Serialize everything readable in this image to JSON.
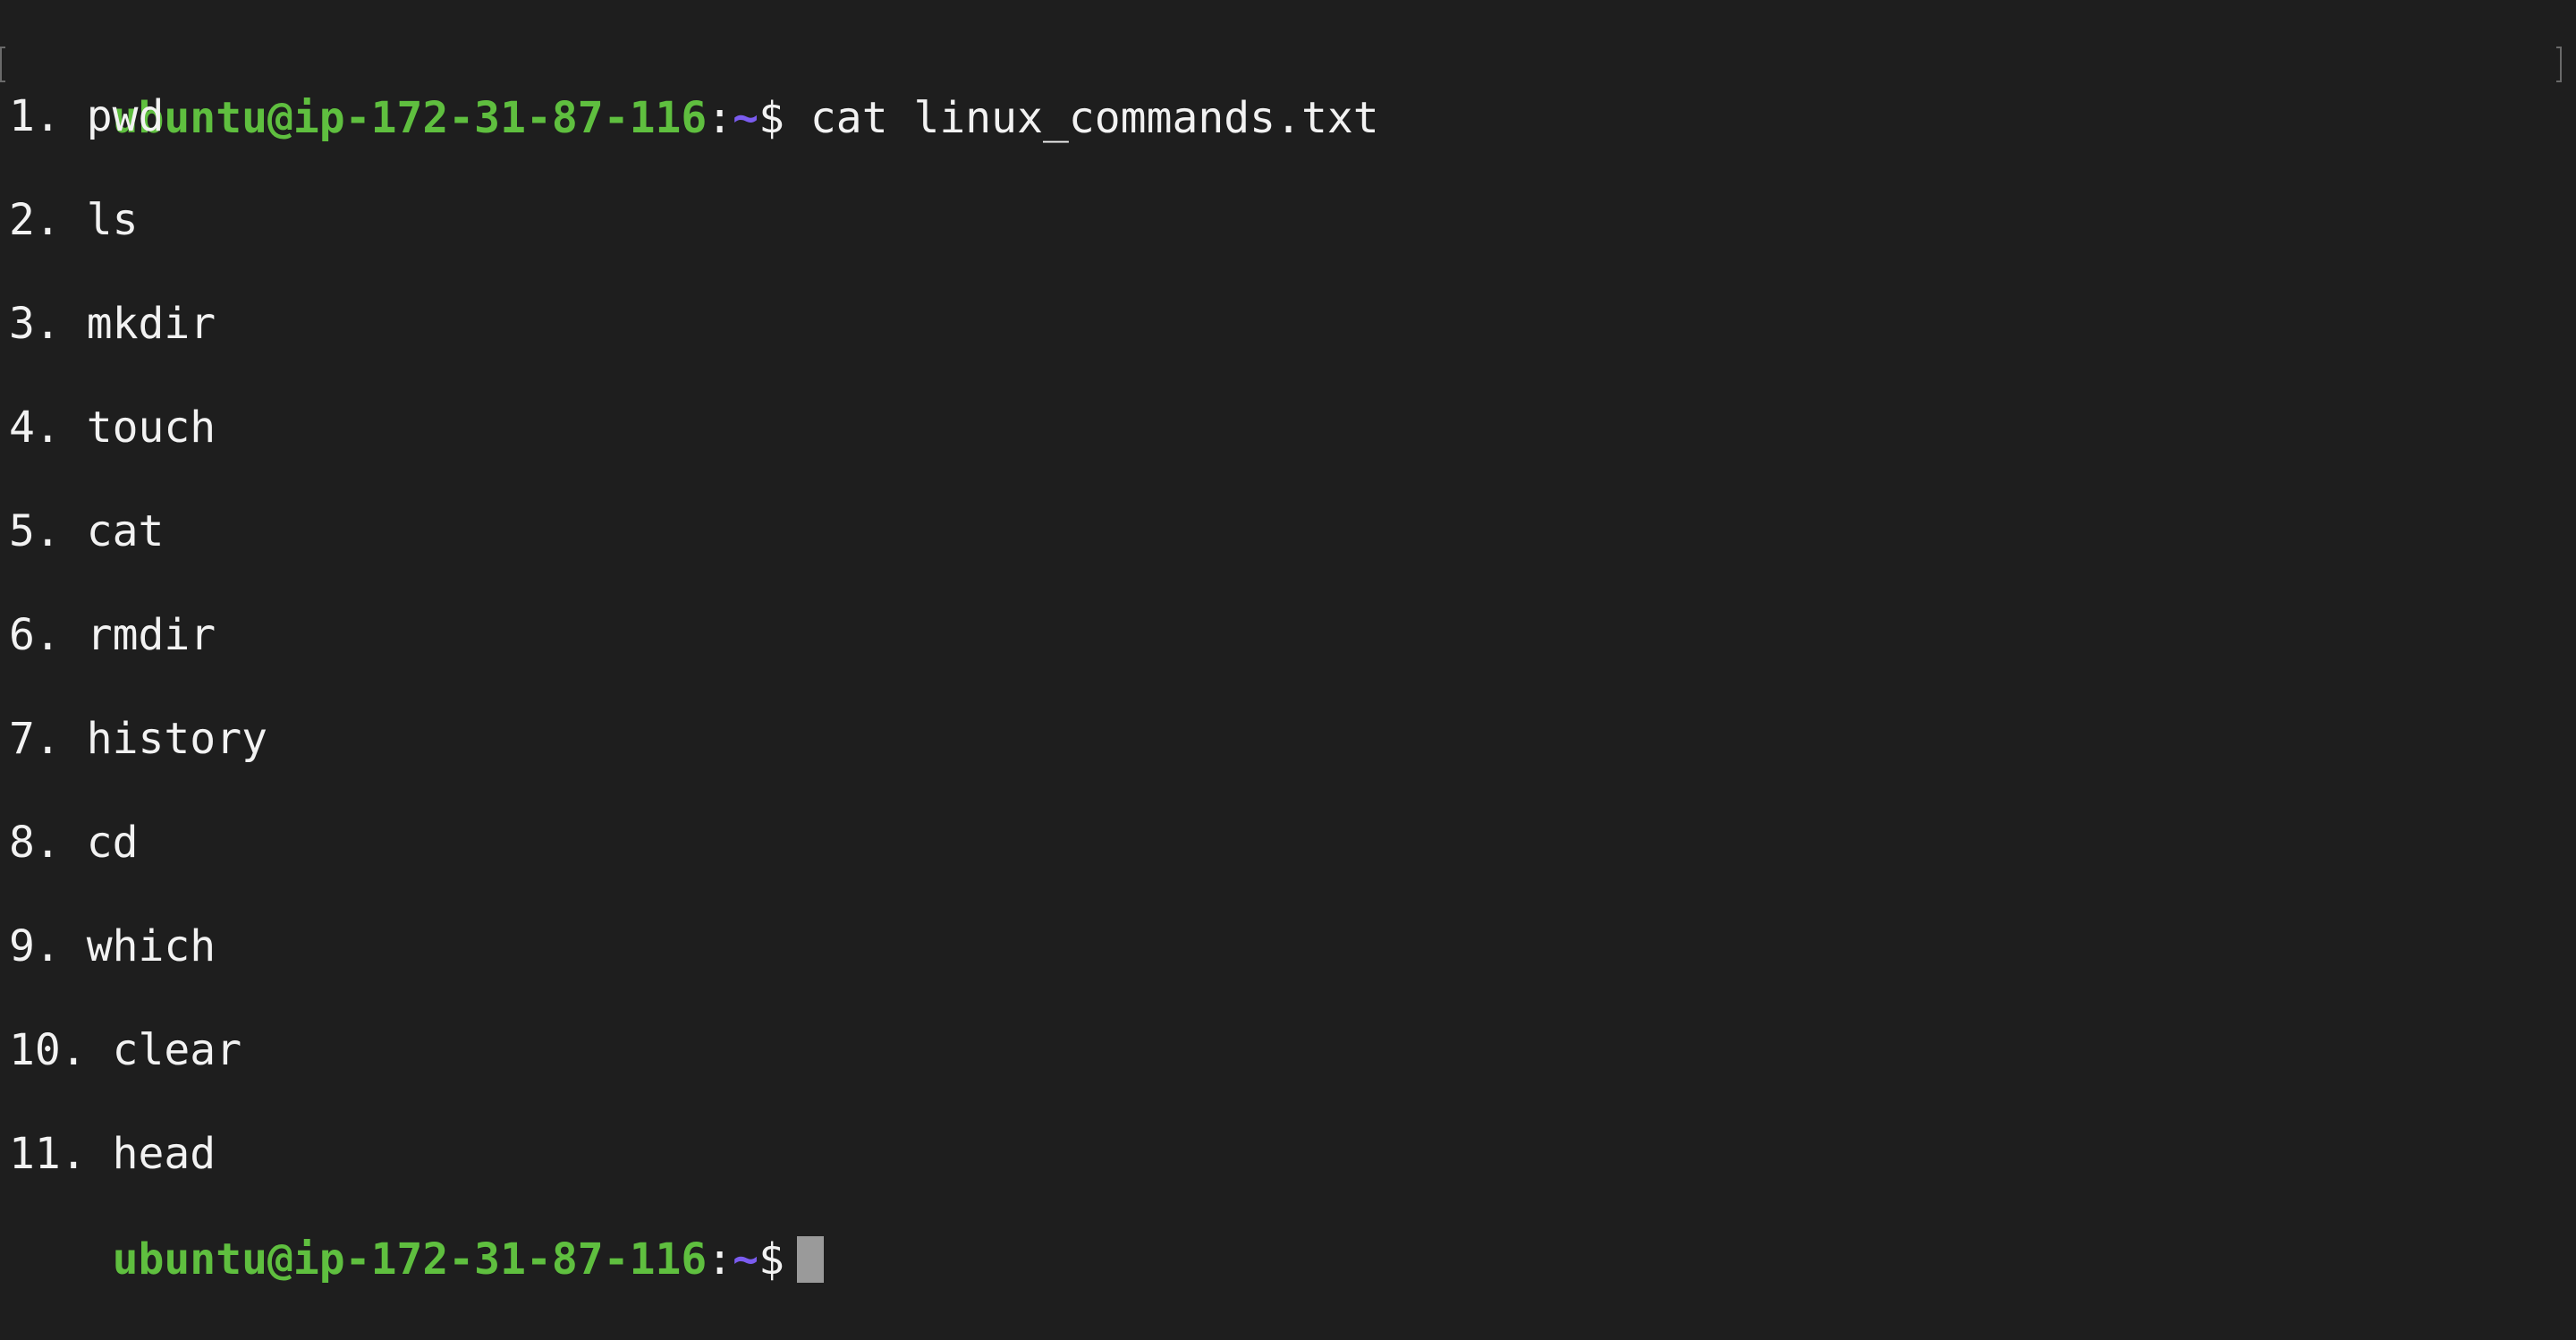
{
  "prompt": {
    "user_host": "ubuntu@ip-172-31-87-116",
    "colon": ":",
    "path": "~",
    "dollar": "$"
  },
  "command": "cat linux_commands.txt",
  "output_lines": [
    "1. pwd",
    "",
    "2. ls",
    "",
    "3. mkdir",
    "",
    "4. touch",
    "",
    "5. cat",
    "",
    "6. rmdir",
    "",
    "7. history",
    "",
    "8. cd",
    "",
    "9. which",
    "",
    "10. clear",
    "",
    "11. head"
  ],
  "colors": {
    "background": "#1e1e1e",
    "text": "#f2f2f2",
    "prompt_user": "#5fbf3f",
    "prompt_path": "#7b5cf0",
    "cursor": "#9a9a9a"
  }
}
